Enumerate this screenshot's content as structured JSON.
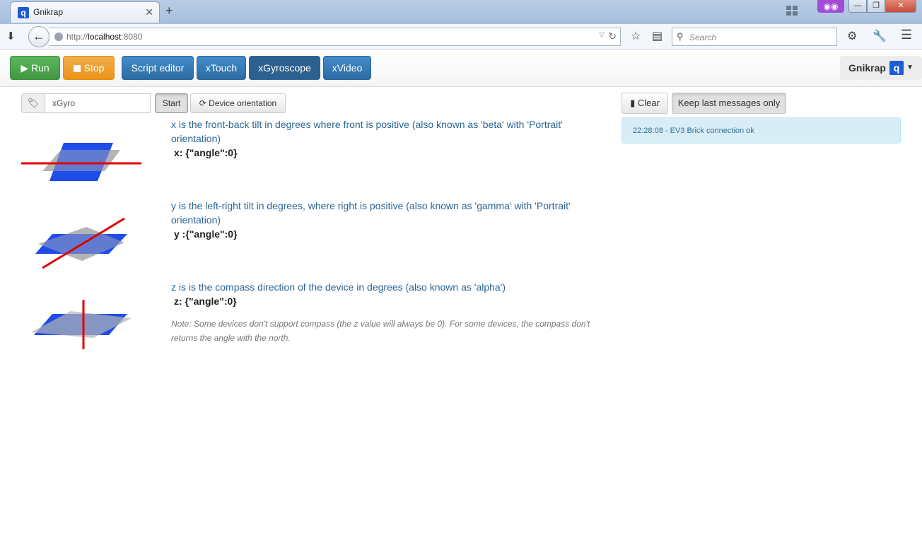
{
  "browser": {
    "tab_title": "Gnikrap",
    "tab_favicon": "q",
    "url_prefix": "http://",
    "url_host": "localhost",
    "url_port": ":8080",
    "search_placeholder": "Search",
    "icons": [
      "download-icon",
      "back-icon",
      "reload-icon",
      "bookmark-star-icon",
      "reader-icon",
      "gear-icon",
      "wrench-icon",
      "menu-icon"
    ]
  },
  "toolbar": {
    "run_label": "Run",
    "stop_label": "Stop",
    "script_editor_label": "Script editor",
    "xtouch_label": "xTouch",
    "xgyroscope_label": "xGyroscope",
    "xvideo_label": "xVideo",
    "brand_label": "Gnikrap",
    "brand_logo": "q"
  },
  "sensor": {
    "name_value": "xGyro",
    "start_label": "Start",
    "orientation_label": "Device orientation"
  },
  "axes": [
    {
      "description": "x is the front-back tilt in degrees where front is positive (also known as 'beta' with 'Portrait' orientation)",
      "value": "x: {\"angle\":0}"
    },
    {
      "description": "y is the left-right tilt in degrees, where right is positive (also known as 'gamma' with 'Portrait' orientation)",
      "value": "y :{\"angle\":0}"
    },
    {
      "description": "z is is the compass direction of the device in degrees (also known as 'alpha')",
      "value": "z: {\"angle\":0}"
    }
  ],
  "note": "Note: Some devices don't support compass (the z value will always be 0). For some devices, the compass don't returns the angle with the north.",
  "messages": {
    "clear_label": "Clear",
    "keep_label": "Keep last messages only",
    "log": [
      "22:28:08 - EV3 Brick connection ok"
    ]
  },
  "colors": {
    "run": "#5cb85c",
    "stop": "#f0ad4e",
    "primary": "#428bca",
    "axis_line": "#e00000",
    "plane_blue": "#1f4de8",
    "plane_gray": "#b4b4b4"
  }
}
